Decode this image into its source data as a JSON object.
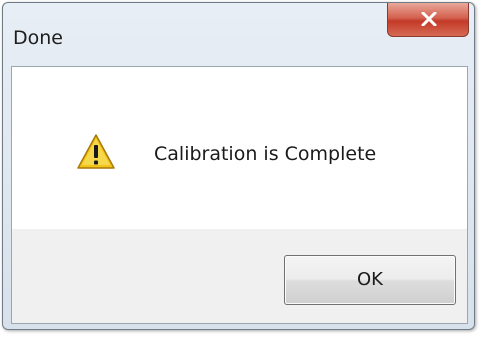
{
  "window": {
    "title": "Done",
    "close_icon": "close-icon"
  },
  "dialog": {
    "icon": "warning-icon",
    "message": "Calibration is Complete",
    "ok_label": "OK"
  },
  "colors": {
    "close_button": "#c94a37",
    "warning_yellow": "#f2c318"
  }
}
